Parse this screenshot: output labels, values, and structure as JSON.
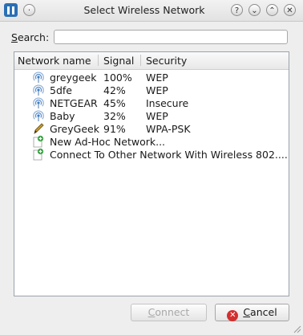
{
  "window": {
    "title": "Select Wireless Network"
  },
  "search": {
    "label": "Search:",
    "value": ""
  },
  "table": {
    "headers": [
      "Network name",
      "Signal",
      "Security"
    ],
    "rows": [
      {
        "name": "greygeek",
        "signal": "100%",
        "security": "WEP",
        "icon": "wifi-signal-icon"
      },
      {
        "name": "5dfe",
        "signal": "42%",
        "security": "WEP",
        "icon": "wifi-signal-icon"
      },
      {
        "name": "NETGEAR",
        "signal": "45%",
        "security": "Insecure",
        "icon": "wifi-signal-icon"
      },
      {
        "name": "Baby",
        "signal": "32%",
        "security": "WEP",
        "icon": "wifi-signal-icon"
      },
      {
        "name": "GreyGeek",
        "signal": "91%",
        "security": "WPA-PSK",
        "icon": "edit-pencil-icon"
      },
      {
        "name": "New Ad-Hoc Network...",
        "signal": "",
        "security": "",
        "icon": "add-document-icon"
      },
      {
        "name": "Connect To Other Network With Wireless 802....",
        "signal": "",
        "security": "",
        "icon": "add-document-icon"
      }
    ]
  },
  "buttons": {
    "connect": "Connect",
    "cancel": "Cancel"
  }
}
